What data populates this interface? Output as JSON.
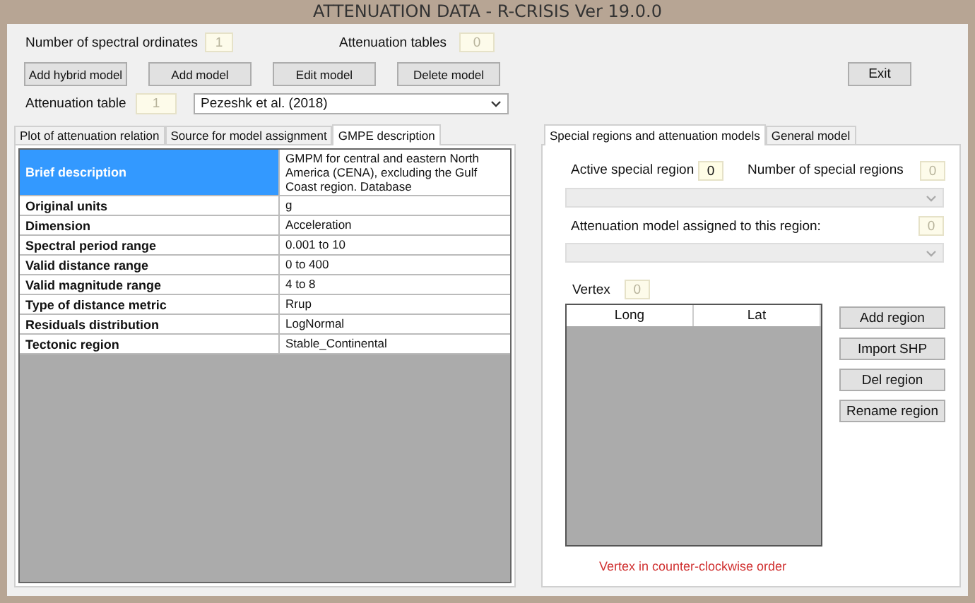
{
  "window": {
    "title": "ATTENUATION DATA - R-CRISIS Ver 19.0.0"
  },
  "top_fields": [
    {
      "label": "Number of spectral ordinates",
      "value": "1",
      "disabled": true
    },
    {
      "label": "Attenuation tables",
      "value": "0",
      "disabled": true
    }
  ],
  "model_buttons": [
    "Add hybrid model",
    "Add model",
    "Edit model",
    "Delete model"
  ],
  "exit_button": "Exit",
  "attenuation_table": {
    "label": "Attenuation table",
    "value": "1",
    "disabled": true,
    "model": "Pezeshk et al. (2018)"
  },
  "left_tabs": [
    {
      "label": "Plot of attenuation relation",
      "selected": false
    },
    {
      "label": "Source for model assignment",
      "selected": false
    },
    {
      "label": "GMPE description",
      "selected": true
    }
  ],
  "gmpe_table": [
    {
      "property": "Brief description",
      "value": "GMPM for central and eastern North America (CENA), excluding the Gulf Coast region. Database",
      "selected": true
    },
    {
      "property": "Original units",
      "value": "g",
      "selected": false
    },
    {
      "property": "Dimension",
      "value": "Acceleration",
      "selected": false
    },
    {
      "property": "Spectral period range",
      "value": "0.001 to 10",
      "selected": false
    },
    {
      "property": "Valid distance range",
      "value": "0 to 400",
      "selected": false
    },
    {
      "property": "Valid magnitude range",
      "value": "4 to 8",
      "selected": false
    },
    {
      "property": "Type of distance metric",
      "value": "Rrup",
      "selected": false
    },
    {
      "property": "Residuals distribution",
      "value": "LogNormal",
      "selected": false
    },
    {
      "property": "Tectonic region",
      "value": "Stable_Continental",
      "selected": false
    }
  ],
  "right_tabs": [
    {
      "label": "Special regions and attenuation models",
      "selected": true
    },
    {
      "label": "General model",
      "selected": false
    }
  ],
  "special_regions": {
    "active_region": {
      "label": "Active special region",
      "value": "0",
      "disabled": false
    },
    "region_count": {
      "label": "Number of special regions",
      "value": "0",
      "disabled": true
    },
    "assigned_model": {
      "label": "Attenuation model assigned to this region:",
      "value": "0",
      "disabled": true
    },
    "vertex": {
      "label": "Vertex",
      "value": "0",
      "disabled": true
    },
    "vertex_columns": [
      "Long",
      "Lat"
    ],
    "buttons": [
      "Add region",
      "Import SHP",
      "Del region",
      "Rename region"
    ],
    "note": "Vertex in counter-clockwise order"
  }
}
